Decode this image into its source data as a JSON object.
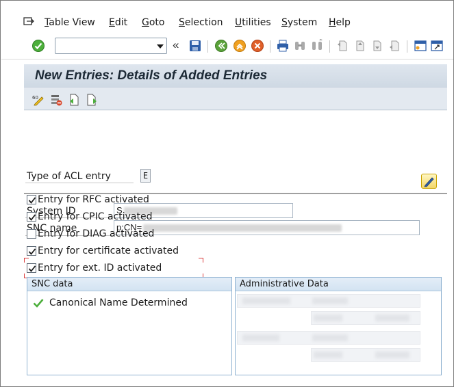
{
  "menu": {
    "items": [
      {
        "label": "Table View",
        "accel": "T",
        "rest": "able View"
      },
      {
        "label": "Edit",
        "accel": "E",
        "rest": "dit"
      },
      {
        "label": "Goto",
        "accel": "G",
        "rest": "oto"
      },
      {
        "label": "Selection",
        "accel": "S",
        "rest": "election"
      },
      {
        "label": "Utilities",
        "accel": "U",
        "rest": "tilities"
      },
      {
        "label": "System",
        "accel": "S",
        "rest": "ystem"
      },
      {
        "label": "Help",
        "accel": "H",
        "rest": "elp"
      }
    ]
  },
  "toolbar": {
    "command_value": "",
    "back_glyph": "«"
  },
  "screen": {
    "title": "New Entries: Details of Added Entries"
  },
  "form": {
    "acl_type_label": "Type of ACL entry",
    "acl_type_value": "E",
    "system_id_label": "System ID",
    "system_id_prefix": "S",
    "snc_name_label": "SNC name",
    "snc_name_prefix": "p:CN=",
    "checkboxes": [
      {
        "label": "Entry for RFC activated",
        "checked": true
      },
      {
        "label": "Entry for CPIC activated",
        "checked": true
      },
      {
        "label": "Entry for DIAG activated",
        "checked": false
      },
      {
        "label": "Entry for certificate activated",
        "checked": true
      },
      {
        "label": "Entry for ext. ID activated",
        "checked": true
      }
    ]
  },
  "snc_group": {
    "title": "SNC data",
    "status_text": "Canonical Name Determined"
  },
  "admin_group": {
    "title": "Administrative Data"
  },
  "colors": {
    "accent_green": "#4caf3b",
    "focus_red": "#d93a3a",
    "group_border": "#8fb2d1"
  }
}
